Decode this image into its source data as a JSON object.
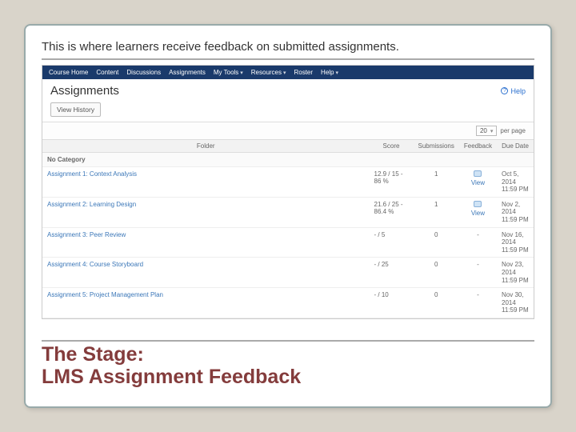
{
  "caption_top": "This is where learners receive feedback on submitted assignments.",
  "title_line1": "The Stage:",
  "title_line2": "LMS Assignment Feedback",
  "nav": {
    "items": [
      "Course Home",
      "Content",
      "Discussions",
      "Assignments",
      "My Tools",
      "Resources",
      "Roster",
      "Help"
    ]
  },
  "page": {
    "heading": "Assignments",
    "help_label": "Help",
    "view_history": "View History",
    "perpage_value": "20",
    "perpage_label": "per page"
  },
  "table": {
    "headers": {
      "folder": "Folder",
      "score": "Score",
      "submissions": "Submissions",
      "feedback": "Feedback",
      "due": "Due Date"
    },
    "nocat": "No Category",
    "rows": [
      {
        "name": "Assignment 1: Context Analysis",
        "score": "12.9 / 15 - 86 %",
        "submissions": "1",
        "feedback": "View",
        "due": "Oct 5, 2014 11:59 PM"
      },
      {
        "name": "Assignment 2: Learning Design",
        "score": "21.6 / 25 - 86.4 %",
        "submissions": "1",
        "feedback": "View",
        "due": "Nov 2, 2014 11:59 PM"
      },
      {
        "name": "Assignment 3: Peer Review",
        "score": "- / 5",
        "submissions": "0",
        "feedback": "-",
        "due": "Nov 16, 2014 11:59 PM"
      },
      {
        "name": "Assignment 4: Course Storyboard",
        "score": "- / 25",
        "submissions": "0",
        "feedback": "-",
        "due": "Nov 23, 2014 11:59 PM"
      },
      {
        "name": "Assignment 5: Project Management Plan",
        "score": "- / 10",
        "submissions": "0",
        "feedback": "-",
        "due": "Nov 30, 2014 11:59 PM"
      }
    ]
  }
}
